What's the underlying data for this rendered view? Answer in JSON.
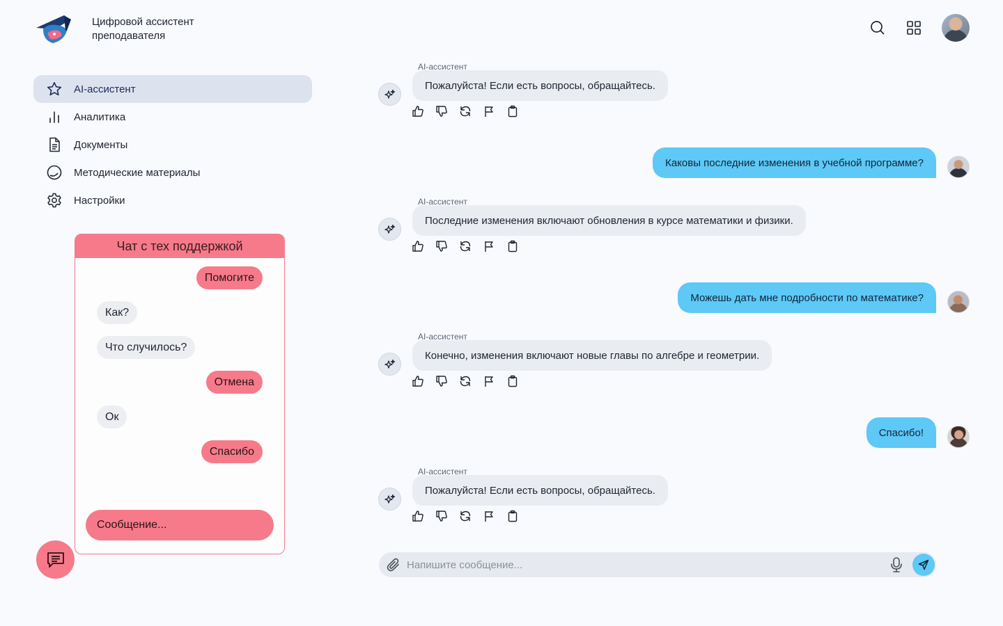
{
  "header": {
    "app_title": "Цифровой ассистент преподавателя",
    "icons": [
      "logo-icon",
      "search-icon",
      "apps-grid-icon",
      "user-avatar"
    ]
  },
  "sidebar": {
    "items": [
      {
        "label": "AI-ассистент",
        "icon": "star-icon",
        "active": true
      },
      {
        "label": "Аналитика",
        "icon": "bar-chart-icon",
        "active": false
      },
      {
        "label": "Документы",
        "icon": "document-icon",
        "active": false
      },
      {
        "label": "Методические материалы",
        "icon": "circle-icon",
        "active": false
      },
      {
        "label": "Настройки",
        "icon": "gear-icon",
        "active": false
      }
    ]
  },
  "support_chat": {
    "title": "Чат с тех поддержкой",
    "messages": [
      {
        "text": "Помогите",
        "from": "me"
      },
      {
        "text": "Как?",
        "from": "them"
      },
      {
        "text": "Что случилось?",
        "from": "them"
      },
      {
        "text": "Отмена",
        "from": "me"
      },
      {
        "text": "Ок",
        "from": "them"
      },
      {
        "text": "Спасибо",
        "from": "me"
      }
    ],
    "input_value": "Сообщение..."
  },
  "chat": {
    "assistant_name": "AI-ассистент",
    "messages": [
      {
        "role": "assistant",
        "text": "Пожалуйста! Если есть вопросы, обращайтесь."
      },
      {
        "role": "user",
        "text": "Каковы последние изменения в учебной программе?"
      },
      {
        "role": "assistant",
        "text": "Последние изменения включают обновления в курсе математики и физики."
      },
      {
        "role": "user",
        "text": "Можешь дать мне подробности по математике?"
      },
      {
        "role": "assistant",
        "text": "Конечно, изменения включают новые главы по алгебре и геометрии."
      },
      {
        "role": "user",
        "text": "Спасибо!"
      },
      {
        "role": "assistant",
        "text": "Пожалуйста! Если есть вопросы, обращайтесь."
      }
    ],
    "message_actions": [
      "like-icon",
      "dislike-icon",
      "regenerate-icon",
      "flag-icon",
      "copy-icon"
    ]
  },
  "composer": {
    "placeholder": "Напишите сообщение...",
    "value": ""
  },
  "colors": {
    "accent_blue": "#5ec8f6",
    "support_pink": "#f77a8a",
    "active_nav": "#dde3ee",
    "ai_bubble": "#e9ecf1",
    "background": "#f8fafd"
  }
}
